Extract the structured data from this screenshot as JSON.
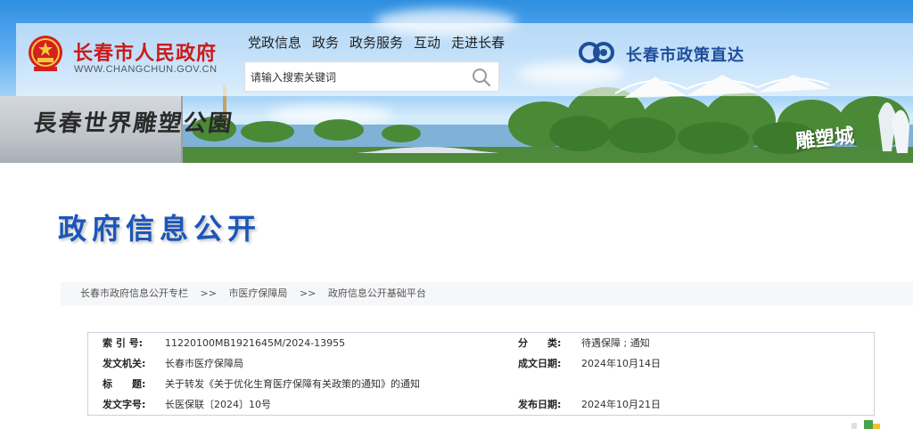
{
  "header": {
    "site_title": "长春市人民政府",
    "site_domain": "WWW.CHANGCHUN.GOV.CN",
    "nav": [
      "党政信息",
      "政务",
      "政务服务",
      "互动",
      "走进长春"
    ],
    "search_placeholder": "请输入搜索关键词",
    "policy_brand": "长春市政策直达",
    "stone_text": "長春世界雕塑公園",
    "city_script": "雕塑城"
  },
  "page": {
    "section_title": "政府信息公开",
    "breadcrumb": [
      "长春市政府信息公开专栏",
      "市医疗保障局",
      "政府信息公开基础平台"
    ],
    "breadcrumb_separator": ">>"
  },
  "info": {
    "index_label": "索 引 号:",
    "index_value": "11220100MB1921645M/2024-13955",
    "category_label": "分　　类:",
    "category_value": "待遇保障 ; 通知",
    "issuer_label": "发文机关:",
    "issuer_value": "长春市医疗保障局",
    "written_label": "成文日期:",
    "written_value": "2024年10月14日",
    "title_label": "标　　题:",
    "title_value": "关于转发《关于优化生育医疗保障有关政策的通知》的通知",
    "doc_no_label": "发文字号:",
    "doc_no_value": "长医保联〔2024〕10号",
    "publish_label": "发布日期:",
    "publish_value": "2024年10月21日"
  },
  "colors": {
    "title_red": "#cc1a1a",
    "brand_blue": "#1f4e9a",
    "section_blue": "#1b56b8"
  }
}
